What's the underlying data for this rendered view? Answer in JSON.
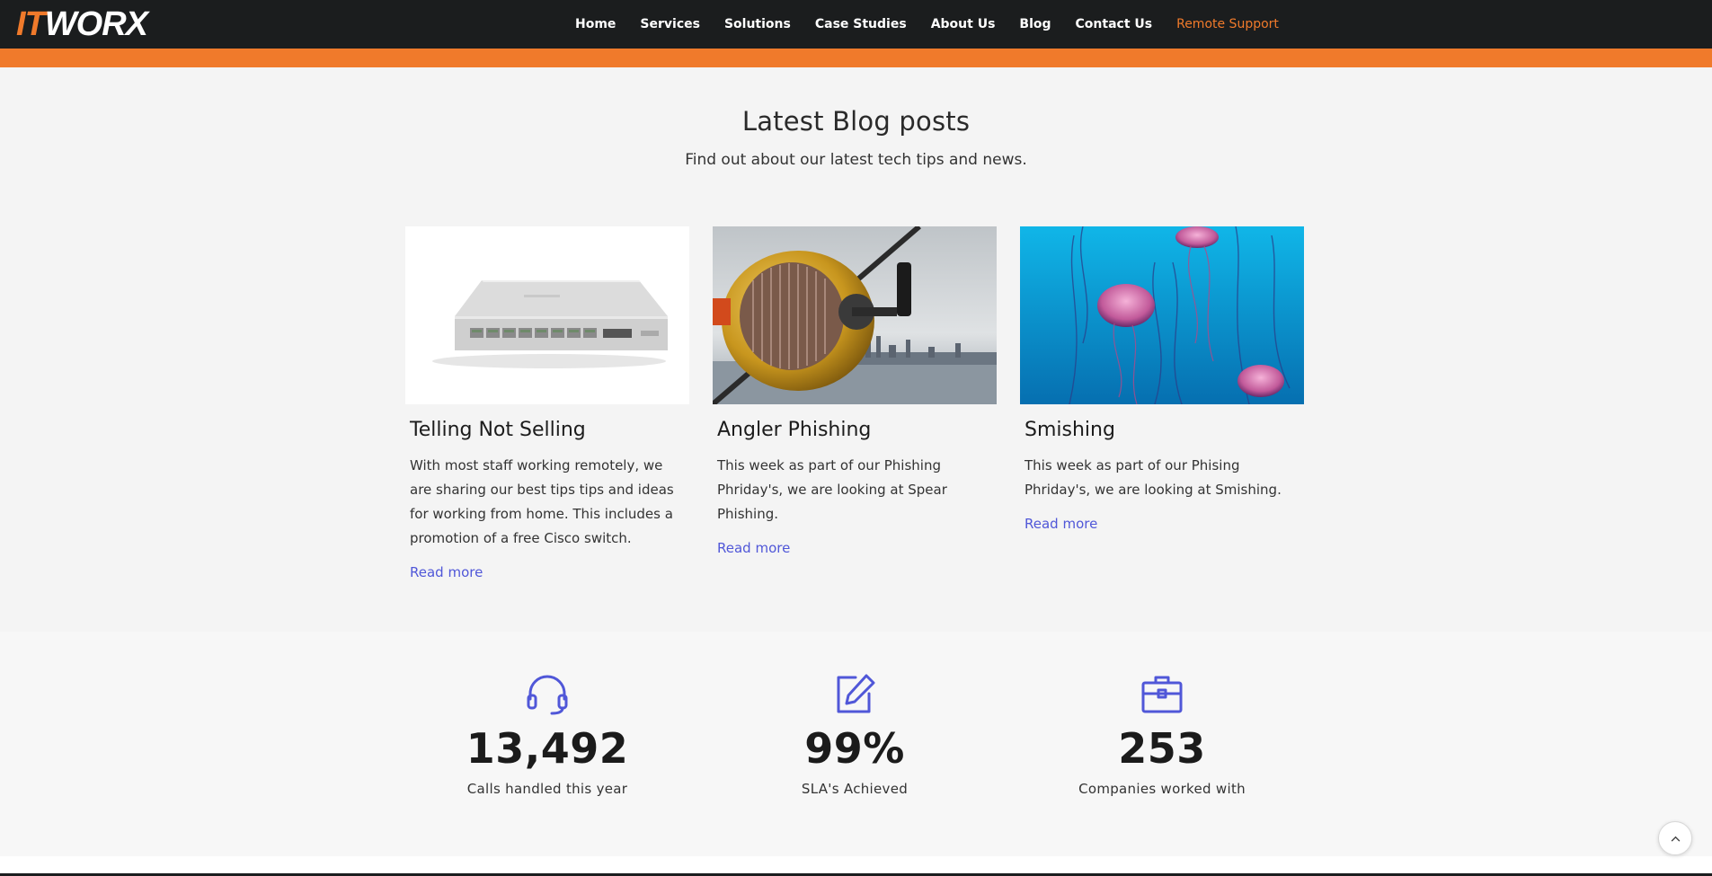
{
  "brand": {
    "logo_it": "IT",
    "logo_worx": "WORX",
    "accent_color": "#f07a2b",
    "dark_color": "#1b1d1e",
    "link_color": "#5057d8"
  },
  "nav": {
    "items": [
      {
        "label": "Home"
      },
      {
        "label": "Services"
      },
      {
        "label": "Solutions"
      },
      {
        "label": "Case Studies"
      },
      {
        "label": "About Us"
      },
      {
        "label": "Blog"
      },
      {
        "label": "Contact Us"
      },
      {
        "label": "Remote Support"
      }
    ]
  },
  "blog": {
    "title": "Latest Blog posts",
    "subtitle": "Find out about our latest tech tips and news.",
    "posts": [
      {
        "title": "Telling Not Selling",
        "excerpt": "With most staff working remotely, we are sharing our best tips tips and ideas for working from home. This includes a promotion of a free Cisco switch.",
        "link": "Read more",
        "image": "network-switch-image"
      },
      {
        "title": "Angler Phishing",
        "excerpt": "This week as part of our Phishing Phriday's, we are looking at Spear Phishing.",
        "link": "Read more",
        "image": "fishing-reel-image"
      },
      {
        "title": "Smishing",
        "excerpt": "This week as part of our Phising Phriday's, we are looking at Smishing.",
        "link": "Read more",
        "image": "jellyfish-image"
      }
    ]
  },
  "stats": [
    {
      "icon": "headset-icon",
      "value": "13,492",
      "label": "Calls handled this year"
    },
    {
      "icon": "edit-icon",
      "value": "99%",
      "label": "SLA's Achieved"
    },
    {
      "icon": "briefcase-icon",
      "value": "253",
      "label": "Companies worked with"
    }
  ],
  "scroll_top": {
    "icon": "chevron-up-icon"
  }
}
